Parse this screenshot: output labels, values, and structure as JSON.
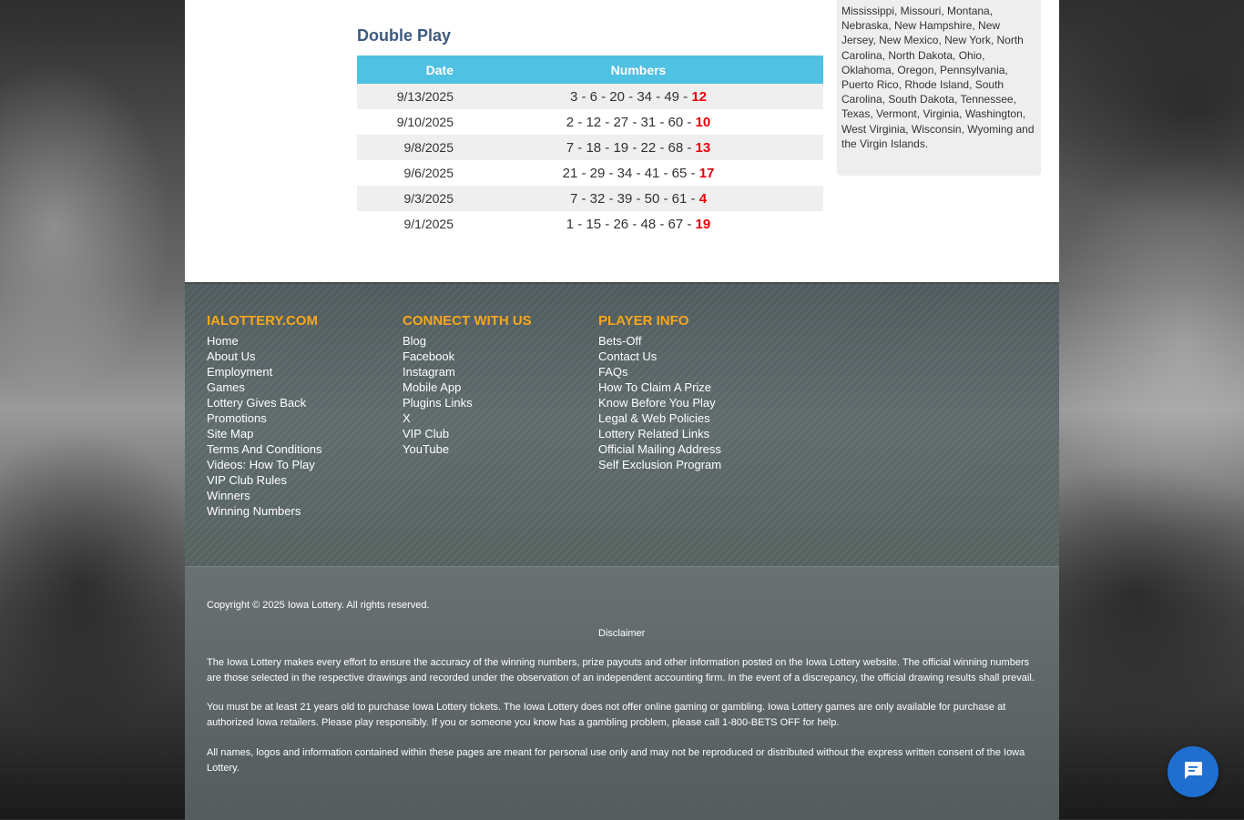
{
  "double_play": {
    "title": "Double Play",
    "headers": {
      "date": "Date",
      "numbers": "Numbers"
    },
    "rows": [
      {
        "date": "9/13/2025",
        "main": "3 - 6 - 20 - 34 - 49 - ",
        "bonus": "12"
      },
      {
        "date": "9/10/2025",
        "main": "2 - 12 - 27 - 31 - 60 - ",
        "bonus": "10"
      },
      {
        "date": "9/8/2025",
        "main": "7 - 18 - 19 - 22 - 68 - ",
        "bonus": "13"
      },
      {
        "date": "9/6/2025",
        "main": "21 - 29 - 34 - 41 - 65 - ",
        "bonus": "17"
      },
      {
        "date": "9/3/2025",
        "main": "7 - 32 - 39 - 50 - 61 - ",
        "bonus": "4"
      },
      {
        "date": "9/1/2025",
        "main": "1 - 15 - 26 - 48 - 67 - ",
        "bonus": "19"
      }
    ]
  },
  "sidebar": {
    "states_text": "Mississippi, Missouri, Montana, Nebraska, New Hampshire, New Jersey, New Mexico, New York, North Carolina, North Dakota, Ohio, Oklahoma, Oregon, Pennsylvania, Puerto Rico, Rhode Island, South Carolina, South Dakota, Tennessee, Texas, Vermont, Virginia, Washington, West Virginia, Wisconsin, Wyoming and the Virgin Islands."
  },
  "footer": {
    "ialottery": {
      "heading": "IALOTTERY.COM",
      "links": [
        "Home",
        "About Us",
        "Employment",
        "Games",
        "Lottery Gives Back",
        "Promotions",
        "Site Map",
        "Terms And Conditions",
        "Videos: How To Play",
        "VIP Club Rules",
        "Winners",
        "Winning Numbers"
      ]
    },
    "connect": {
      "heading": "CONNECT WITH US",
      "links": [
        "Blog",
        "Facebook",
        "Instagram",
        "Mobile App",
        "Plugins Links",
        "X",
        "VIP Club",
        "YouTube"
      ]
    },
    "player_info": {
      "heading": "PLAYER INFO",
      "links": [
        "Bets-Off",
        "Contact Us",
        "FAQs",
        "How To Claim A Prize",
        "Know Before You Play",
        "Legal & Web Policies",
        "Lottery Related Links",
        "Official Mailing Address",
        "Self Exclusion Program"
      ]
    }
  },
  "legal": {
    "copyright": "Copyright © 2025 Iowa Lottery. All rights reserved.",
    "disclaimer_title": "Disclaimer",
    "disclaimer_text": "The Iowa Lottery makes every effort to ensure the accuracy of the winning numbers, prize payouts and other information posted on the Iowa Lottery website. The official winning numbers are those selected in the respective drawings and recorded under the observation of an independent accounting firm. In the event of a discrepancy, the official drawing results shall prevail.",
    "age_text": "You must be at least 21 years old to purchase Iowa Lottery tickets. The Iowa Lottery does not offer online gaming or gambling. Iowa Lottery games are only available for purchase at authorized Iowa retailers. Please play responsibly. If you or someone you know has a gambling problem, please call 1-800-BETS OFF for help.",
    "rights_text": "All names, logos and information contained within these pages are meant for personal use only and may not be reproduced or distributed without the express written consent of the Iowa Lottery."
  },
  "chat": {
    "icon": "chat-bubble-icon",
    "color": "#1e6fd0"
  }
}
